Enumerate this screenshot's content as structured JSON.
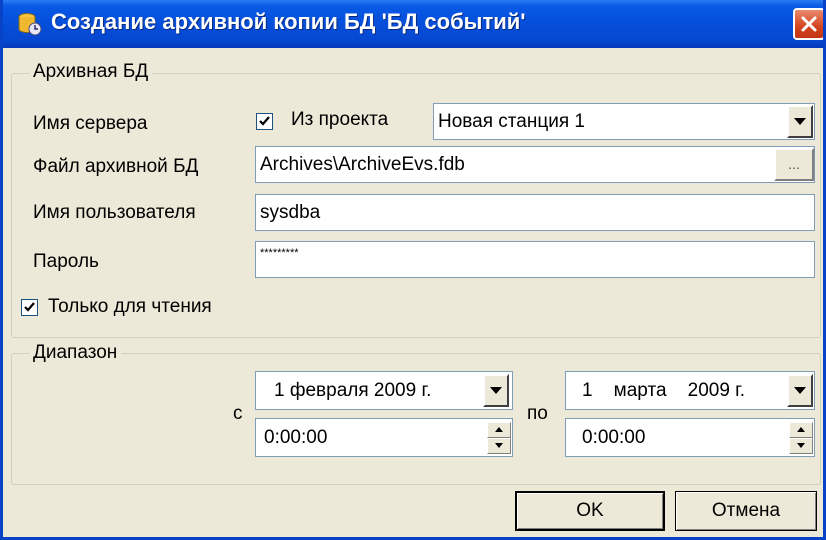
{
  "window": {
    "title": "Создание архивной копии БД 'БД событий'"
  },
  "archive_group": {
    "legend": "Архивная БД",
    "server_label": "Имя сервера",
    "from_project_checked": true,
    "from_project_label": "Из проекта",
    "server_value": "Новая станция 1",
    "file_label": "Файл архивной БД",
    "file_value": "Archives\\ArchiveEvs.fdb",
    "browse_label": "...",
    "user_label": "Имя пользователя",
    "user_value": "sysdba",
    "password_label": "Пароль",
    "password_value": "*********",
    "readonly_checked": true,
    "readonly_label": "Только для чтения"
  },
  "range_group": {
    "legend": "Диапазон",
    "from_label": "с",
    "from_date": "1 февраля  2009 г.",
    "from_time": "0:00:00",
    "to_label": "по",
    "to_date": "1    марта    2009 г.",
    "to_time": "0:00:00"
  },
  "buttons": {
    "ok": "OK",
    "cancel": "Отмена"
  },
  "colors": {
    "titlebar": "#0551de",
    "close": "#d3451f",
    "background": "#ece9d8"
  }
}
